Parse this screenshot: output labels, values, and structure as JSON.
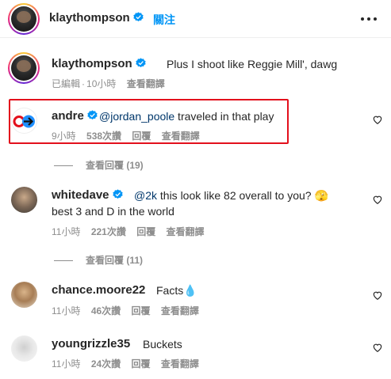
{
  "header": {
    "username": "klaythompson",
    "follow_label": "關注"
  },
  "caption": {
    "username": "klaythompson",
    "text": "Plus I shoot like Reggie Mill', dawg",
    "edited_label": "已編輯",
    "time": "10小時",
    "translate_label": "查看翻譯"
  },
  "comments": [
    {
      "username": "andre",
      "mention": "@jordan_poole",
      "text": " traveled in that play",
      "time": "9小時",
      "likes": "538次讚",
      "reply_label": "回覆",
      "translate_label": "查看翻譯",
      "view_replies": "查看回覆 (19)"
    },
    {
      "username": "whitedave",
      "mention": "@2k",
      "text": " this look like 82 overall to you? 🫣",
      "text_line2": "best 3 and D in the world",
      "time": "11小時",
      "likes": "221次讚",
      "reply_label": "回覆",
      "translate_label": "查看翻譯",
      "view_replies": "查看回覆 (11)"
    },
    {
      "username": "chance.moore22",
      "text": "Facts💧",
      "time": "11小時",
      "likes": "46次讚",
      "reply_label": "回覆",
      "translate_label": "查看翻譯"
    },
    {
      "username": "youngrizzle35",
      "text": "Buckets",
      "time": "11小時",
      "likes": "24次讚",
      "reply_label": "回覆",
      "translate_label": "查看翻譯"
    }
  ],
  "colors": {
    "verified": "#0095f6",
    "link": "#00376b",
    "highlight": "#e3101c",
    "meta": "#8e8e8e"
  }
}
